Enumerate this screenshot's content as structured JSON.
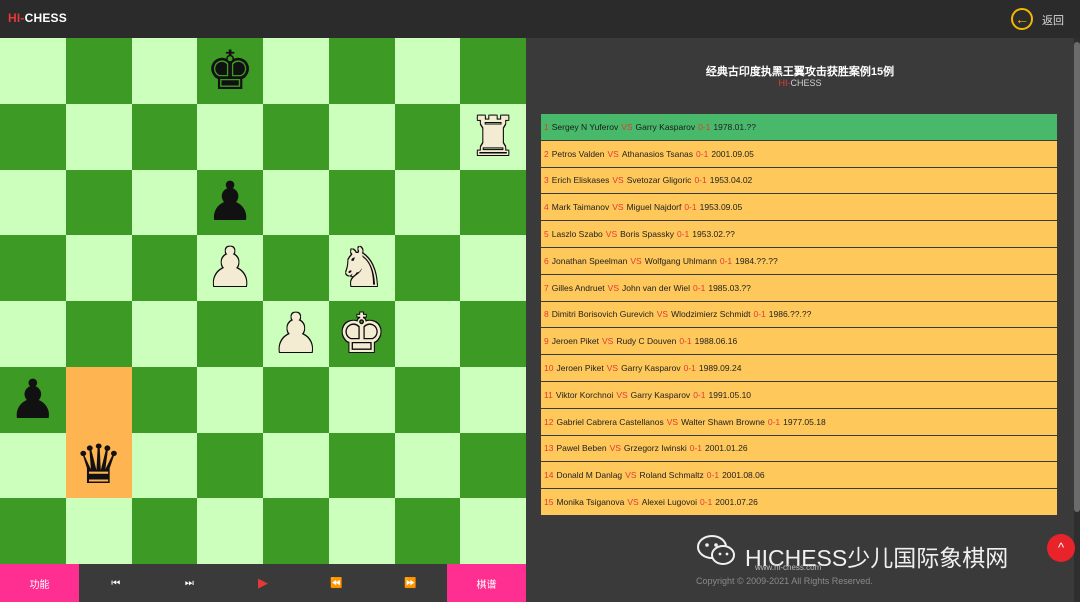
{
  "header": {
    "logo_hi": "HI-",
    "logo_chess": "CHESS",
    "back_icon": "back-arrow-icon",
    "back_label": "返回"
  },
  "board": {
    "highlight_squares": [
      "b3",
      "b2"
    ],
    "pieces": [
      {
        "square": "d8",
        "color": "black",
        "type": "king",
        "glyph": "♚"
      },
      {
        "square": "h7",
        "color": "white",
        "type": "rook",
        "glyph": "♜"
      },
      {
        "square": "d6",
        "color": "black",
        "type": "pawn",
        "glyph": "♟"
      },
      {
        "square": "d5",
        "color": "white",
        "type": "pawn",
        "glyph": "♟"
      },
      {
        "square": "f5",
        "color": "white",
        "type": "knight",
        "glyph": "♞"
      },
      {
        "square": "e4",
        "color": "white",
        "type": "pawn",
        "glyph": "♟"
      },
      {
        "square": "f4",
        "color": "white",
        "type": "king",
        "glyph": "♚"
      },
      {
        "square": "a3",
        "color": "black",
        "type": "pawn",
        "glyph": "♟"
      },
      {
        "square": "b2",
        "color": "black",
        "type": "queen",
        "glyph": "♛"
      }
    ]
  },
  "controls": {
    "function_label": "功能",
    "first_icon": "⏮",
    "next_icon": "⏭",
    "play_icon": "▶",
    "rewind_icon": "⏪",
    "forward_icon": "⏩",
    "list_label": "棋谱"
  },
  "panel": {
    "title": "经典古印度执黑王翼攻击获胜案例15例",
    "subtitle_hi": "HI-",
    "subtitle_chess": "CHESS",
    "games": [
      {
        "index": "1",
        "white": "Sergey N Yuferov",
        "black": "Garry Kasparov",
        "result": "0-1",
        "date": "1978.01.??",
        "active": true
      },
      {
        "index": "2",
        "white": "Petros Valden",
        "black": "Athanasios Tsanas",
        "result": "0-1",
        "date": "2001.09.05"
      },
      {
        "index": "3",
        "white": "Erich Eliskases",
        "black": "Svetozar Gligoric",
        "result": "0-1",
        "date": "1953.04.02"
      },
      {
        "index": "4",
        "white": "Mark Taimanov",
        "black": "Miguel Najdorf",
        "result": "0-1",
        "date": "1953.09.05"
      },
      {
        "index": "5",
        "white": "Laszlo Szabo",
        "black": "Boris Spassky",
        "result": "0-1",
        "date": "1953.02.??"
      },
      {
        "index": "6",
        "white": "Jonathan Speelman",
        "black": "Wolfgang Uhlmann",
        "result": "0-1",
        "date": "1984.??.??"
      },
      {
        "index": "7",
        "white": "Gilles Andruet",
        "black": "John van der Wiel",
        "result": "0-1",
        "date": "1985.03.??"
      },
      {
        "index": "8",
        "white": "Dimitri Borisovich Gurevich",
        "black": "Wlodzimierz Schmidt",
        "result": "0-1",
        "date": "1986.??.??"
      },
      {
        "index": "9",
        "white": "Jeroen Piket",
        "black": "Rudy C Douven",
        "result": "0-1",
        "date": "1988.06.16"
      },
      {
        "index": "10",
        "white": "Jeroen Piket",
        "black": "Garry Kasparov",
        "result": "0-1",
        "date": "1989.09.24"
      },
      {
        "index": "11",
        "white": "Viktor Korchnoi",
        "black": "Garry Kasparov",
        "result": "0-1",
        "date": "1991.05.10"
      },
      {
        "index": "12",
        "white": "Gabriel Cabrera Castellanos",
        "black": "Walter Shawn Browne",
        "result": "0-1",
        "date": "1977.05.18"
      },
      {
        "index": "13",
        "white": "Pawel Beben",
        "black": "Grzegorz Iwinski",
        "result": "0-1",
        "date": "2001.01.26"
      },
      {
        "index": "14",
        "white": "Donald M Danlag",
        "black": "Roland Schmaltz",
        "result": "0-1",
        "date": "2001.08.06"
      },
      {
        "index": "15",
        "white": "Monika Tsiganova",
        "black": "Alexei Lugovoi",
        "result": "0-1",
        "date": "2001.07.26"
      }
    ],
    "vs_label": "VS"
  },
  "footer": {
    "watermark_icon": "wechat-icon",
    "watermark_text": "HICHESS少儿国际象棋网",
    "url": "www.hi-chess.com",
    "copyright": "Copyright © 2009-2021 All Rights Reserved.",
    "scroll_top_icon": "up-arrow-icon"
  },
  "colors": {
    "light_square": "#ccffbb",
    "dark_square": "#3d9b25",
    "highlight_square": "#ffb452",
    "row_bg": "#ffc85a",
    "row_active_bg": "#48b96b",
    "accent_red": "#e53935",
    "accent_pink": "#ff2f92",
    "back_yellow": "#f2b800"
  }
}
